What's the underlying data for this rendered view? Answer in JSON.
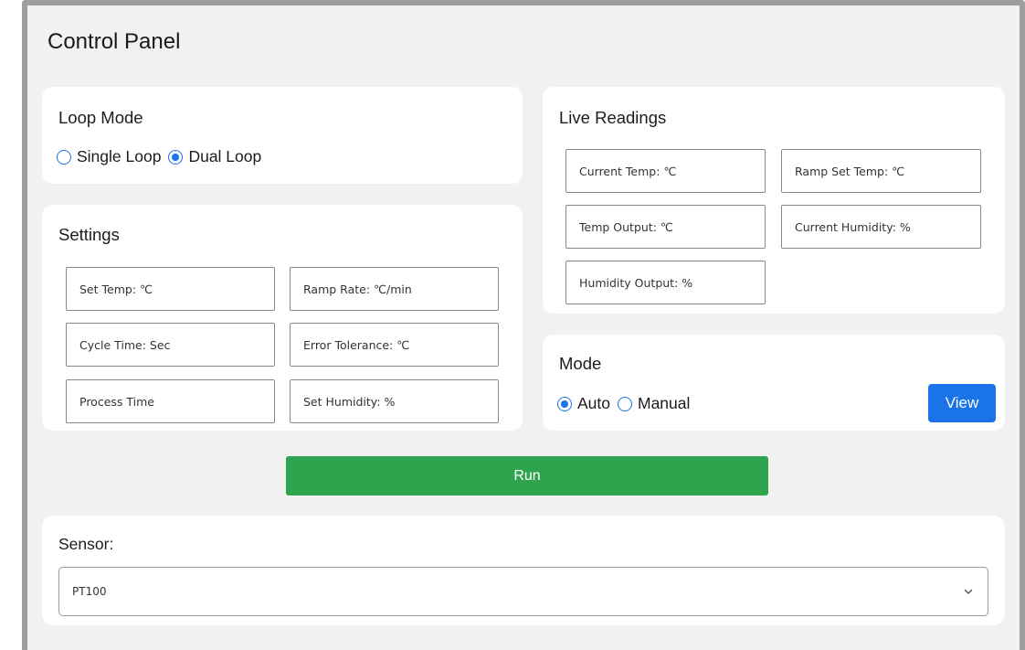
{
  "page": {
    "title": "Control Panel"
  },
  "loop_mode": {
    "title": "Loop Mode",
    "options": [
      {
        "label": "Single Loop",
        "checked": false
      },
      {
        "label": "Dual Loop",
        "checked": true
      }
    ]
  },
  "settings": {
    "title": "Settings",
    "fields": [
      "Set Temp: ℃",
      "Ramp Rate: ℃/min",
      "Cycle Time: Sec",
      "Error Tolerance: ℃",
      "Process Time",
      "Set Humidity: %"
    ]
  },
  "live_readings": {
    "title": "Live Readings",
    "fields": [
      "Current Temp: ℃",
      "Ramp Set Temp: ℃",
      "Temp Output: ℃",
      "Current Humidity: %",
      "Humidity Output: %"
    ]
  },
  "mode": {
    "title": "Mode",
    "options": [
      {
        "label": "Auto",
        "checked": true
      },
      {
        "label": "Manual",
        "checked": false
      }
    ],
    "view_label": "View"
  },
  "run": {
    "label": "Run"
  },
  "sensor": {
    "label": "Sensor:",
    "selected": "PT100"
  },
  "colors": {
    "accent": "#1a73e8",
    "run": "#2ea44f",
    "panel_bg": "#f1f1f1",
    "card_bg": "#ffffff"
  },
  "icons": {
    "select_chevron": "chevron-down-icon"
  }
}
